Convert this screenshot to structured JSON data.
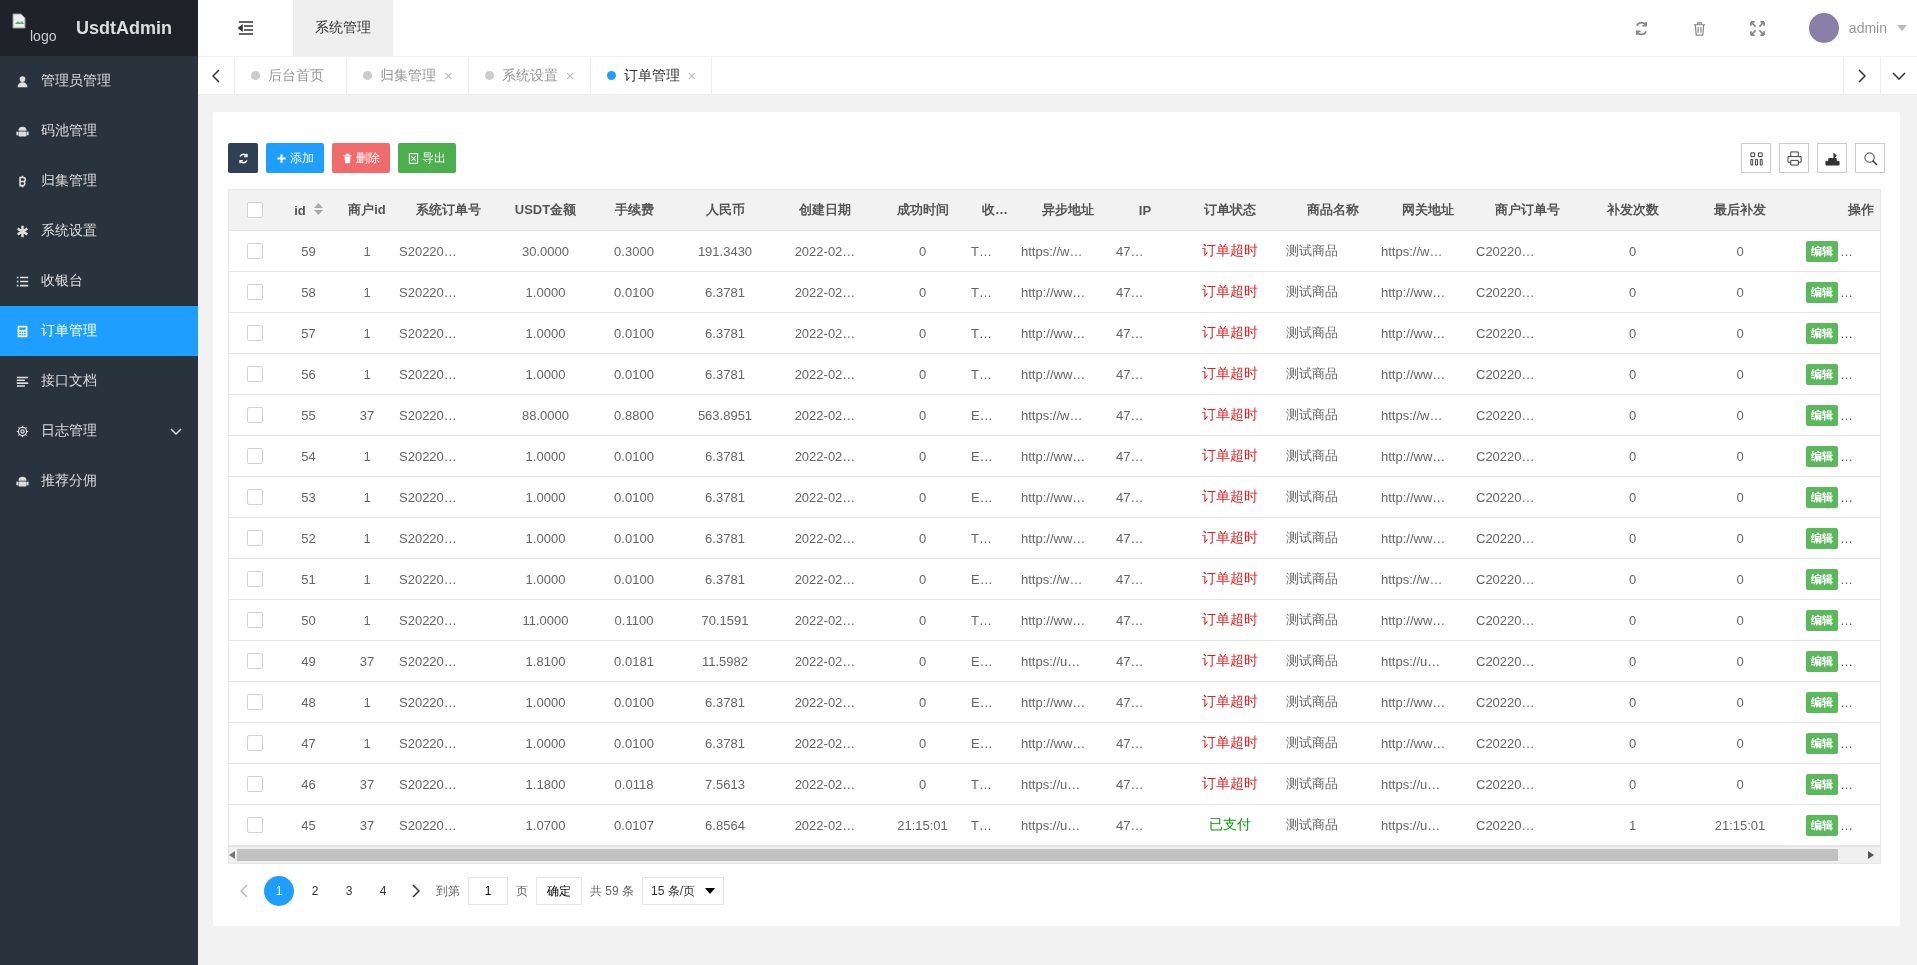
{
  "sidebar": {
    "logo_alt": "logo",
    "title": "UsdtAdmin",
    "items": [
      {
        "label": "管理员管理",
        "kind": "user",
        "selected": false,
        "expandable": false
      },
      {
        "label": "码池管理",
        "kind": "android",
        "selected": false,
        "expandable": false
      },
      {
        "label": "归集管理",
        "kind": "bitcoin",
        "selected": false,
        "expandable": false
      },
      {
        "label": "系统设置",
        "kind": "asterisk",
        "selected": false,
        "expandable": false
      },
      {
        "label": "收银台",
        "kind": "list",
        "selected": false,
        "expandable": false
      },
      {
        "label": "订单管理",
        "kind": "calculator",
        "selected": true,
        "expandable": false
      },
      {
        "label": "接口文档",
        "kind": "align",
        "selected": false,
        "expandable": false
      },
      {
        "label": "日志管理",
        "kind": "gear",
        "selected": false,
        "expandable": true
      },
      {
        "label": "推荐分佣",
        "kind": "android",
        "selected": false,
        "expandable": false
      }
    ]
  },
  "header": {
    "nav_tabs": [
      {
        "label": "系统管理",
        "selected": true
      }
    ],
    "user": "admin"
  },
  "page_tabs": [
    {
      "label": "后台首页",
      "selected": false,
      "closable": false
    },
    {
      "label": "归集管理",
      "selected": false,
      "closable": true
    },
    {
      "label": "系统设置",
      "selected": false,
      "closable": true
    },
    {
      "label": "订单管理",
      "selected": true,
      "closable": true
    }
  ],
  "close_glyph": "×",
  "toolbar": {
    "buttons": [
      {
        "kind": "refresh"
      },
      {
        "kind": "add",
        "label": "添加"
      },
      {
        "kind": "delete",
        "label": "删除"
      },
      {
        "kind": "export",
        "label": "导出"
      }
    ]
  },
  "table": {
    "header_checked": false,
    "columns": [
      "id",
      "商户id",
      "系统订单号",
      "USDT金额",
      "手续费",
      "人民币",
      "创建日期",
      "成功时间",
      "收…",
      "异步地址",
      "IP",
      "订单状态",
      "商品名称",
      "网关地址",
      "商户订单号",
      "补发次数",
      "最后补发",
      "操作"
    ],
    "rows": [
      {
        "checked": false,
        "cells": [
          "59",
          "1",
          "S20220…",
          "30.0000",
          "0.3000",
          "191.3430",
          "2022-02…",
          "0",
          "T…",
          "https://w…",
          "47…"
        ],
        "status": {
          "text": "订单超时",
          "color": "#e02020"
        },
        "rest": [
          "测试商品",
          "https://w…",
          "C20220…",
          "0",
          "0"
        ],
        "action": "编辑",
        "more": "…"
      },
      {
        "checked": false,
        "cells": [
          "58",
          "1",
          "S20220…",
          "1.0000",
          "0.0100",
          "6.3781",
          "2022-02…",
          "0",
          "T…",
          "http://ww…",
          "47…"
        ],
        "status": {
          "text": "订单超时",
          "color": "#e02020"
        },
        "rest": [
          "测试商品",
          "http://ww…",
          "C20220…",
          "0",
          "0"
        ],
        "action": "编辑",
        "more": "…"
      },
      {
        "checked": false,
        "cells": [
          "57",
          "1",
          "S20220…",
          "1.0000",
          "0.0100",
          "6.3781",
          "2022-02…",
          "0",
          "T…",
          "http://ww…",
          "47…"
        ],
        "status": {
          "text": "订单超时",
          "color": "#e02020"
        },
        "rest": [
          "测试商品",
          "http://ww…",
          "C20220…",
          "0",
          "0"
        ],
        "action": "编辑",
        "more": "…"
      },
      {
        "checked": false,
        "cells": [
          "56",
          "1",
          "S20220…",
          "1.0000",
          "0.0100",
          "6.3781",
          "2022-02…",
          "0",
          "T…",
          "http://ww…",
          "47…"
        ],
        "status": {
          "text": "订单超时",
          "color": "#e02020"
        },
        "rest": [
          "测试商品",
          "http://ww…",
          "C20220…",
          "0",
          "0"
        ],
        "action": "编辑",
        "more": "…"
      },
      {
        "checked": false,
        "cells": [
          "55",
          "37",
          "S20220…",
          "88.0000",
          "0.8800",
          "563.8951",
          "2022-02…",
          "0",
          "E…",
          "https://w…",
          "47…"
        ],
        "status": {
          "text": "订单超时",
          "color": "#e02020"
        },
        "rest": [
          "测试商品",
          "https://w…",
          "C20220…",
          "0",
          "0"
        ],
        "action": "编辑",
        "more": "…"
      },
      {
        "checked": false,
        "cells": [
          "54",
          "1",
          "S20220…",
          "1.0000",
          "0.0100",
          "6.3781",
          "2022-02…",
          "0",
          "E…",
          "http://ww…",
          "47…"
        ],
        "status": {
          "text": "订单超时",
          "color": "#e02020"
        },
        "rest": [
          "测试商品",
          "http://ww…",
          "C20220…",
          "0",
          "0"
        ],
        "action": "编辑",
        "more": "…"
      },
      {
        "checked": false,
        "cells": [
          "53",
          "1",
          "S20220…",
          "1.0000",
          "0.0100",
          "6.3781",
          "2022-02…",
          "0",
          "E…",
          "http://ww…",
          "47…"
        ],
        "status": {
          "text": "订单超时",
          "color": "#e02020"
        },
        "rest": [
          "测试商品",
          "http://ww…",
          "C20220…",
          "0",
          "0"
        ],
        "action": "编辑",
        "more": "…"
      },
      {
        "checked": false,
        "cells": [
          "52",
          "1",
          "S20220…",
          "1.0000",
          "0.0100",
          "6.3781",
          "2022-02…",
          "0",
          "T…",
          "http://ww…",
          "47…"
        ],
        "status": {
          "text": "订单超时",
          "color": "#e02020"
        },
        "rest": [
          "测试商品",
          "http://ww…",
          "C20220…",
          "0",
          "0"
        ],
        "action": "编辑",
        "more": "…"
      },
      {
        "checked": false,
        "cells": [
          "51",
          "1",
          "S20220…",
          "1.0000",
          "0.0100",
          "6.3781",
          "2022-02…",
          "0",
          "E…",
          "https://w…",
          "47…"
        ],
        "status": {
          "text": "订单超时",
          "color": "#e02020"
        },
        "rest": [
          "测试商品",
          "https://w…",
          "C20220…",
          "0",
          "0"
        ],
        "action": "编辑",
        "more": "…"
      },
      {
        "checked": false,
        "cells": [
          "50",
          "1",
          "S20220…",
          "11.0000",
          "0.1100",
          "70.1591",
          "2022-02…",
          "0",
          "T…",
          "http://ww…",
          "47…"
        ],
        "status": {
          "text": "订单超时",
          "color": "#e02020"
        },
        "rest": [
          "测试商品",
          "http://ww…",
          "C20220…",
          "0",
          "0"
        ],
        "action": "编辑",
        "more": "…"
      },
      {
        "checked": false,
        "cells": [
          "49",
          "37",
          "S20220…",
          "1.8100",
          "0.0181",
          "11.5982",
          "2022-02…",
          "0",
          "E…",
          "https://u…",
          "47…"
        ],
        "status": {
          "text": "订单超时",
          "color": "#e02020"
        },
        "rest": [
          "测试商品",
          "https://u…",
          "C20220…",
          "0",
          "0"
        ],
        "action": "编辑",
        "more": "…"
      },
      {
        "checked": false,
        "cells": [
          "48",
          "1",
          "S20220…",
          "1.0000",
          "0.0100",
          "6.3781",
          "2022-02…",
          "0",
          "E…",
          "http://ww…",
          "47…"
        ],
        "status": {
          "text": "订单超时",
          "color": "#e02020"
        },
        "rest": [
          "测试商品",
          "http://ww…",
          "C20220…",
          "0",
          "0"
        ],
        "action": "编辑",
        "more": "…"
      },
      {
        "checked": false,
        "cells": [
          "47",
          "1",
          "S20220…",
          "1.0000",
          "0.0100",
          "6.3781",
          "2022-02…",
          "0",
          "E…",
          "http://ww…",
          "47…"
        ],
        "status": {
          "text": "订单超时",
          "color": "#e02020"
        },
        "rest": [
          "测试商品",
          "http://ww…",
          "C20220…",
          "0",
          "0"
        ],
        "action": "编辑",
        "more": "…"
      },
      {
        "checked": false,
        "cells": [
          "46",
          "37",
          "S20220…",
          "1.1800",
          "0.0118",
          "7.5613",
          "2022-02…",
          "0",
          "T…",
          "https://u…",
          "47…"
        ],
        "status": {
          "text": "订单超时",
          "color": "#e02020"
        },
        "rest": [
          "测试商品",
          "https://u…",
          "C20220…",
          "0",
          "0"
        ],
        "action": "编辑",
        "more": "…"
      },
      {
        "checked": false,
        "cells": [
          "45",
          "37",
          "S20220…",
          "1.0700",
          "0.0107",
          "6.8564",
          "2022-02…",
          "21:15:01",
          "T…",
          "https://u…",
          "47…"
        ],
        "status": {
          "text": "已支付",
          "color": "#009900"
        },
        "rest": [
          "测试商品",
          "https://u…",
          "C20220…",
          "1",
          "21:15:01"
        ],
        "action": "编辑",
        "more": "…"
      }
    ]
  },
  "pagination": {
    "pages": [
      {
        "label": "1",
        "selected": true
      },
      {
        "label": "2",
        "selected": false
      },
      {
        "label": "3",
        "selected": false
      },
      {
        "label": "4",
        "selected": false
      }
    ],
    "goto_label": "到第",
    "goto_value": "1",
    "page_unit": "页",
    "confirm": "确定",
    "total": "共 59 条",
    "page_size": "15 条/页"
  }
}
